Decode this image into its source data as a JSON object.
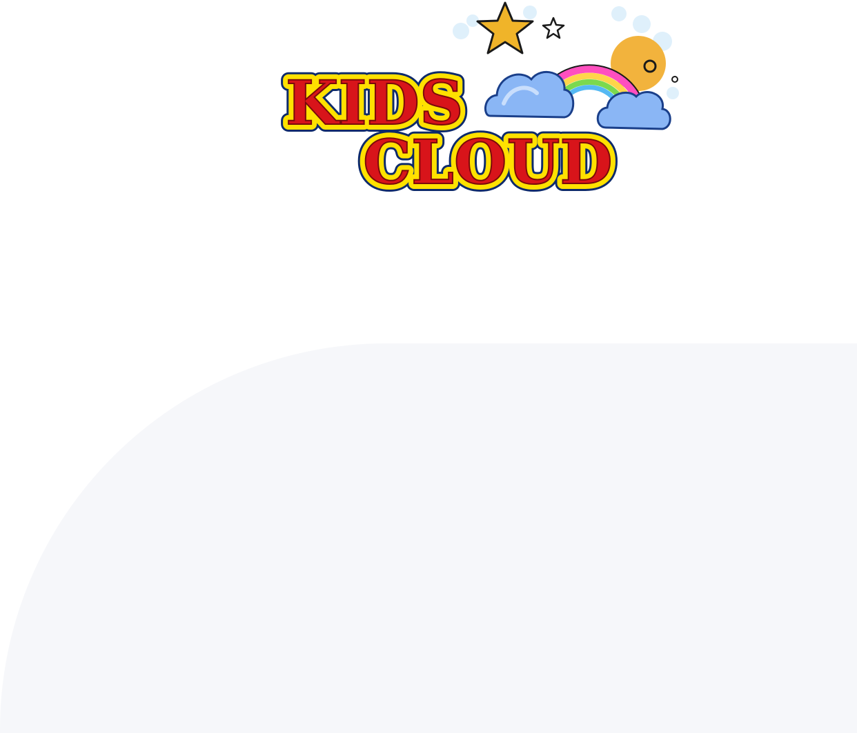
{
  "logo": {
    "line1": "KIDS",
    "line2": "CLOUD",
    "alt": "Kids Cloud logo"
  },
  "colors": {
    "background": "#ffffff",
    "panel": "#f6f7fa",
    "logo_text": "#d8141a",
    "logo_outline_yellow": "#ffe100",
    "logo_outline_navy": "#0d2a6b",
    "star": "#f0b429",
    "sun": "#f2b33d",
    "cloud": "#8ab6f5"
  },
  "icons": [
    "star-icon",
    "small-star-icon",
    "rainbow-icon",
    "sun-icon",
    "cloud-icon"
  ]
}
